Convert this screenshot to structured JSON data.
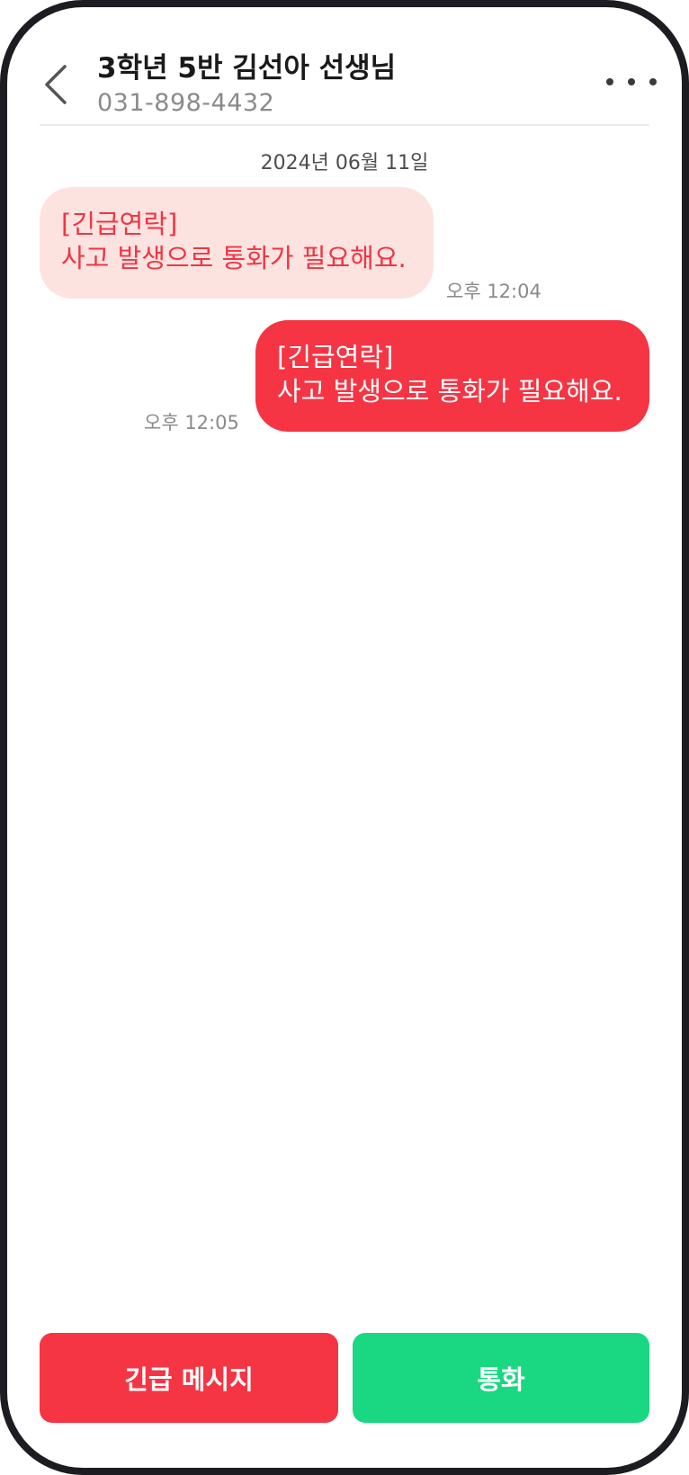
{
  "header": {
    "title": "3학년 5반 김선아 선생님",
    "phone": "031-898-4432",
    "back_icon": "chevron-left-icon",
    "more_icon": "more-horizontal-icon"
  },
  "conversation": {
    "date": "2024년 06월 11일",
    "messages": [
      {
        "direction": "incoming",
        "lines": [
          "[긴급연락]",
          "사고 발생으로 통화가 필요해요."
        ],
        "time": "오후 12:04"
      },
      {
        "direction": "outgoing",
        "lines": [
          "[긴급연락]",
          "사고 발생으로 통화가 필요해요."
        ],
        "time": "오후 12:05"
      }
    ]
  },
  "actions": {
    "emergency_label": "긴급 메시지",
    "call_label": "통화"
  },
  "colors": {
    "accent_red": "#f53544",
    "incoming_bubble_bg": "#fde3e0",
    "call_green": "#1ad882",
    "frame": "#1d1c22"
  }
}
